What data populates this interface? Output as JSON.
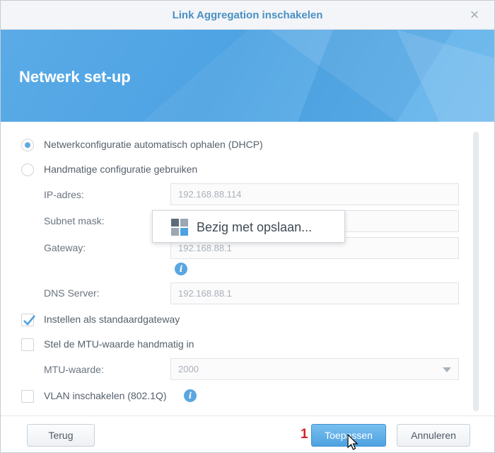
{
  "window": {
    "title": "Link Aggregation inschakelen",
    "close_symbol": "×"
  },
  "banner": {
    "title": "Netwerk set-up"
  },
  "network": {
    "dhcp_label": "Netwerkconfiguratie automatisch ophalen (DHCP)",
    "dhcp_selected": true,
    "manual_label": "Handmatige configuratie gebruiken",
    "ip_label": "IP-adres:",
    "ip_value": "192.168.88.114",
    "subnet_label": "Subnet mask:",
    "subnet_value": "",
    "gateway_label": "Gateway:",
    "gateway_value": "192.168.88.1",
    "dns_label": "DNS Server:",
    "dns_value": "192.168.88.1",
    "default_gateway_label": "Instellen als standaardgateway",
    "default_gateway_checked": true,
    "mtu_manual_label": "Stel de MTU-waarde handmatig in",
    "mtu_label": "MTU-waarde:",
    "mtu_value": "2000",
    "vlan_label": "VLAN inschakelen (802.1Q)"
  },
  "toast": {
    "text": "Bezig met opslaan..."
  },
  "footer": {
    "back_label": "Terug",
    "apply_label": "Toepassen",
    "cancel_label": "Annuleren",
    "step_number": "1"
  },
  "colors": {
    "accent": "#4ea2e0",
    "title": "#4a8fc3",
    "step": "#d3232a"
  },
  "icons": [
    "close-icon",
    "info-icon",
    "check-icon",
    "loading-icon",
    "chevron-down-icon",
    "mouse-pointer-icon"
  ]
}
